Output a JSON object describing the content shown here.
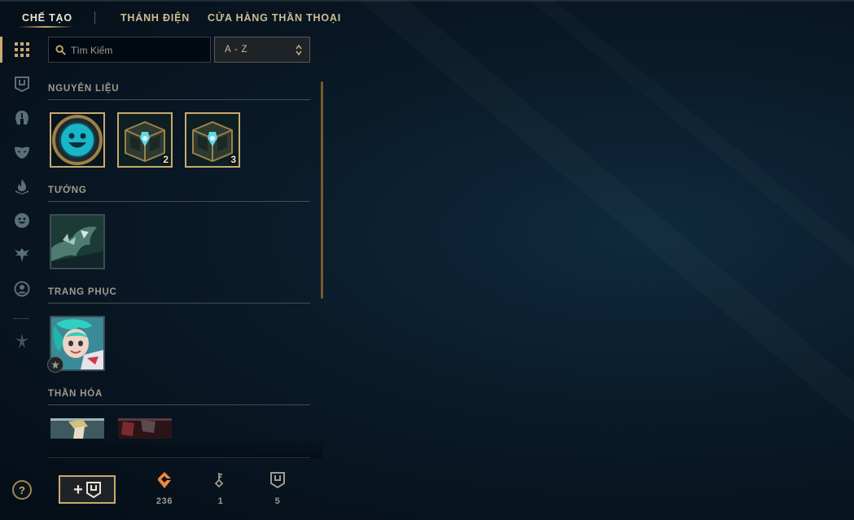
{
  "top_nav": {
    "tabs": [
      {
        "label": "CHẾ TẠO",
        "active": true
      },
      {
        "label": "THÁNH ĐIỆN",
        "active": false
      },
      {
        "label": "CỬA HÀNG THẦN THOẠI",
        "active": false
      }
    ]
  },
  "side_rail": {
    "items": [
      {
        "icon": "grid-icon",
        "active": true
      },
      {
        "icon": "chest-icon",
        "active": false
      },
      {
        "icon": "helmet-icon",
        "active": false
      },
      {
        "icon": "mask-icon",
        "active": false
      },
      {
        "icon": "flame-icon",
        "active": false
      },
      {
        "icon": "emote-icon",
        "active": false
      },
      {
        "icon": "ward-icon",
        "active": false
      },
      {
        "icon": "profile-icon",
        "active": false
      },
      {
        "icon": "trophy-icon",
        "active": false
      }
    ]
  },
  "search": {
    "placeholder": "Tìm Kiếm",
    "value": ""
  },
  "sort": {
    "selected": "A - Z"
  },
  "sections": {
    "materials": {
      "title": "NGUYÊN LIỆU",
      "items": [
        {
          "name": "emote-token",
          "count": ""
        },
        {
          "name": "hextech-chest",
          "count": "2"
        },
        {
          "name": "hextech-chest",
          "count": "3"
        }
      ]
    },
    "champions": {
      "title": "TƯỚNG",
      "items": [
        {
          "name": "champion-shard"
        }
      ]
    },
    "skins": {
      "title": "TRANG PHỤC",
      "items": [
        {
          "name": "skin-shard"
        }
      ]
    },
    "emotes": {
      "title": "THẦN HÓA",
      "items": [
        {
          "name": "emote-shard-1"
        },
        {
          "name": "emote-shard-2"
        }
      ]
    }
  },
  "help": {
    "label": "?"
  },
  "add_chest": {
    "label": "+"
  },
  "currencies": [
    {
      "icon": "orange-essence-icon",
      "value": "236"
    },
    {
      "icon": "key-icon",
      "value": "1"
    },
    {
      "icon": "chest-icon",
      "value": "5"
    }
  ],
  "colors": {
    "gold": "#c8aa6e",
    "gold_light": "#f0e6d2",
    "text_muted": "#a09b8c",
    "orange_essence": "#f0883a",
    "background": "#0a1a28"
  }
}
